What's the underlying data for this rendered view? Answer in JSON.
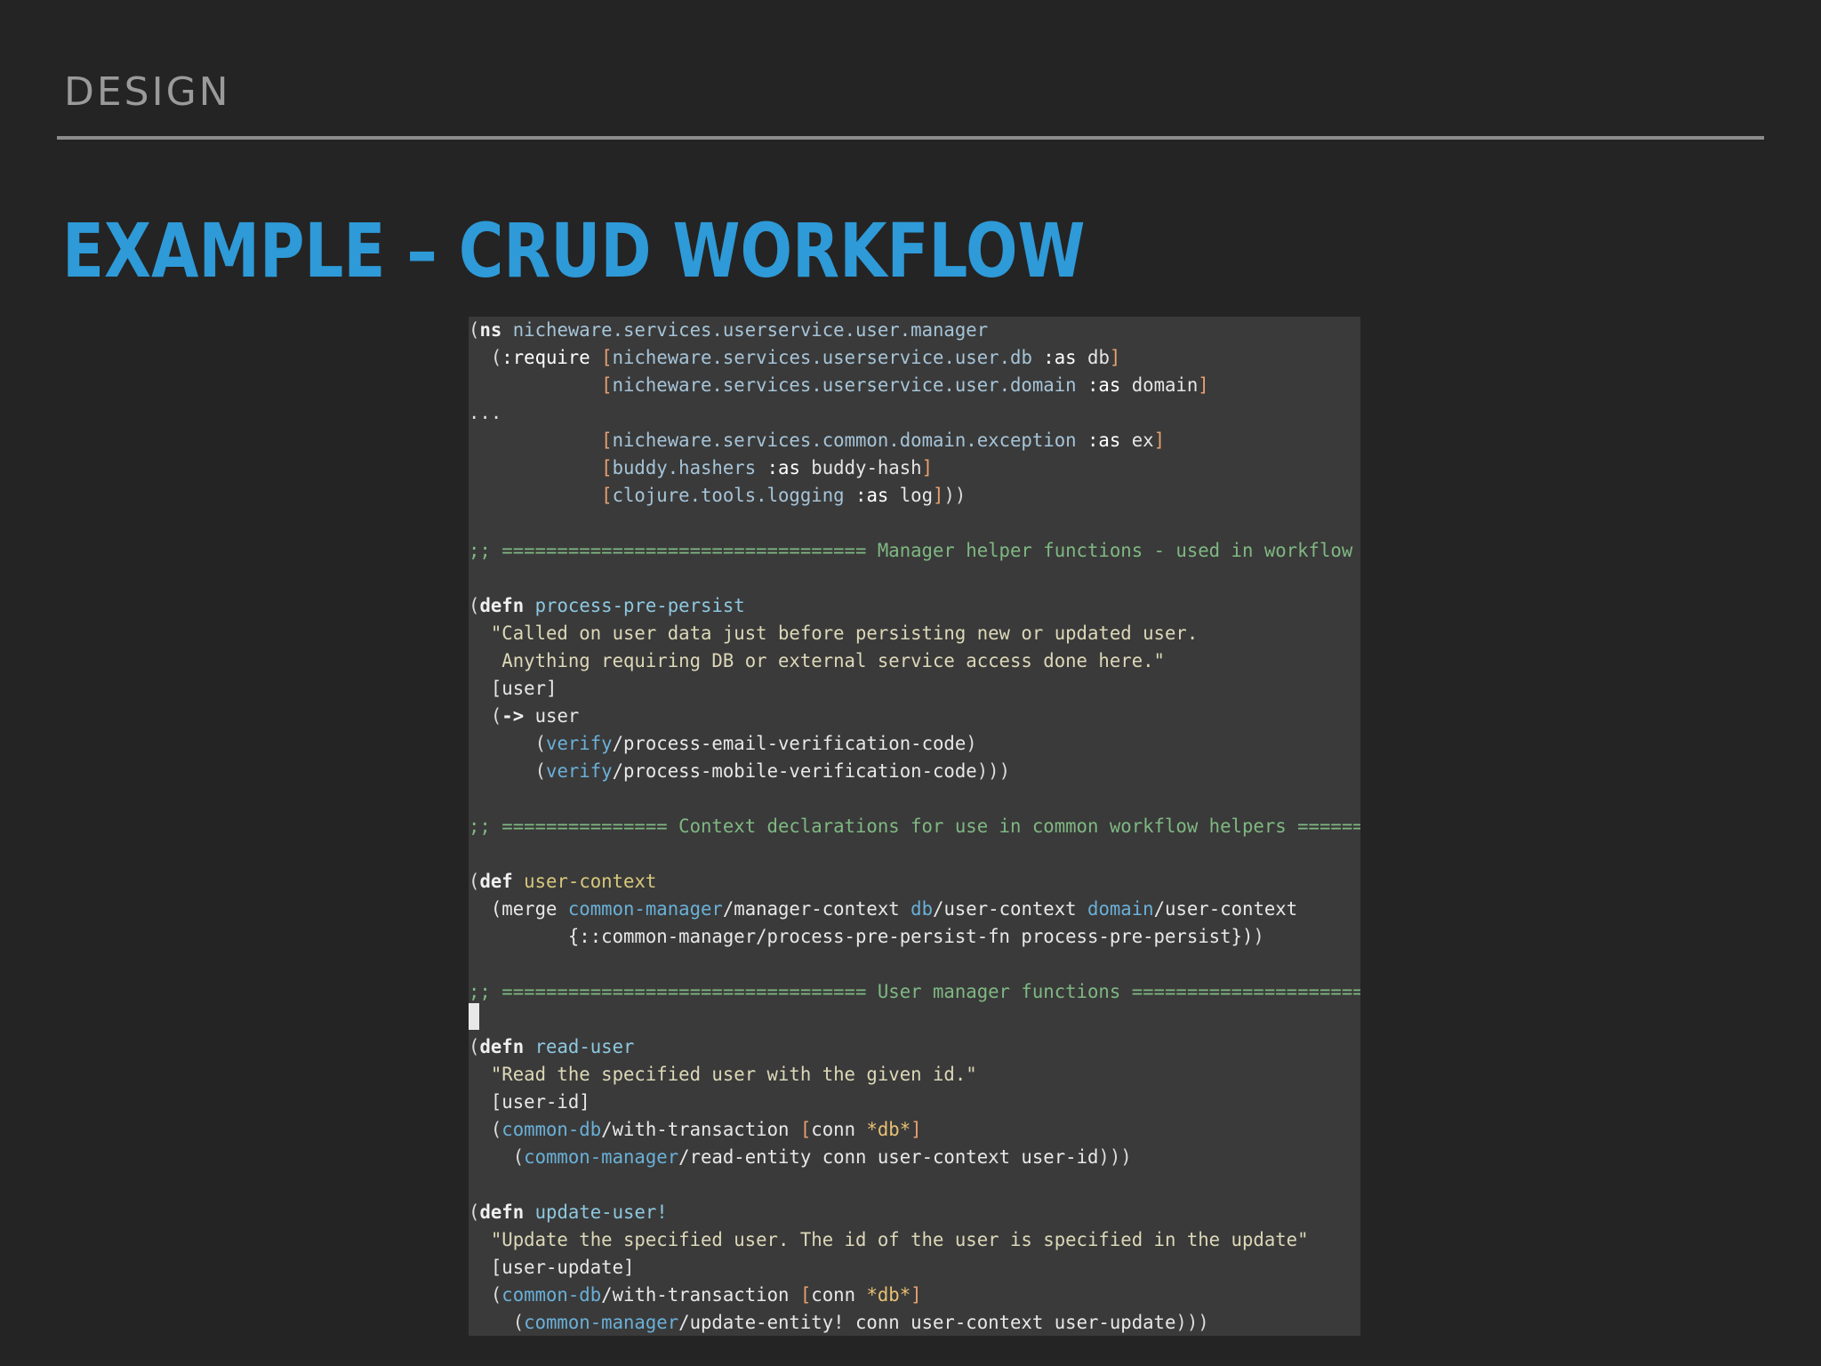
{
  "slide": {
    "section_label": "DESIGN",
    "title": "EXAMPLE – CRUD WORKFLOW"
  },
  "code": {
    "language": "clojure",
    "lines": [
      [
        [
          "(",
          "p"
        ],
        [
          "ns",
          "kw"
        ],
        [
          " nicheware.services.userservice.user.manager",
          "ns"
        ]
      ],
      [
        [
          "  (",
          "p"
        ],
        [
          ":require",
          "kwd"
        ],
        [
          " ",
          "p"
        ],
        [
          "[",
          "br"
        ],
        [
          "nicheware.services.userservice.user.db",
          "ns"
        ],
        [
          " :as ",
          "kwd"
        ],
        [
          "db",
          "nm"
        ],
        [
          "]",
          "br"
        ]
      ],
      [
        [
          "            ",
          "p"
        ],
        [
          "[",
          "br"
        ],
        [
          "nicheware.services.userservice.user.domain",
          "ns"
        ],
        [
          " :as ",
          "kwd"
        ],
        [
          "domain",
          "nm"
        ],
        [
          "]",
          "br"
        ]
      ],
      [
        [
          "...",
          "p"
        ]
      ],
      [
        [
          "            ",
          "p"
        ],
        [
          "[",
          "br"
        ],
        [
          "nicheware.services.common.domain.exception",
          "ns"
        ],
        [
          " :as ",
          "kwd"
        ],
        [
          "ex",
          "nm"
        ],
        [
          "]",
          "br"
        ]
      ],
      [
        [
          "            ",
          "p"
        ],
        [
          "[",
          "br"
        ],
        [
          "buddy.hashers",
          "ns"
        ],
        [
          " :as ",
          "kwd"
        ],
        [
          "buddy-hash",
          "nm"
        ],
        [
          "]",
          "br"
        ]
      ],
      [
        [
          "            ",
          "p"
        ],
        [
          "[",
          "br"
        ],
        [
          "clojure.tools.logging",
          "ns"
        ],
        [
          " :as ",
          "kwd"
        ],
        [
          "log",
          "nm"
        ],
        [
          "]",
          "br"
        ],
        [
          "))",
          "p"
        ]
      ],
      [
        [
          "",
          "p"
        ]
      ],
      [
        [
          ";; ================================= Manager helper functions - used in workflow =====",
          "cm"
        ]
      ],
      [
        [
          "",
          "p"
        ]
      ],
      [
        [
          "(",
          "p"
        ],
        [
          "defn",
          "kw"
        ],
        [
          " ",
          "p"
        ],
        [
          "process-pre-persist",
          "def"
        ]
      ],
      [
        [
          "  \"Called on user data just before persisting new or updated user.",
          "str"
        ]
      ],
      [
        [
          "   Anything requiring DB or external service access done here.\"",
          "str"
        ]
      ],
      [
        [
          "  [user]",
          "sym"
        ]
      ],
      [
        [
          "  (",
          "p"
        ],
        [
          "->",
          "kw"
        ],
        [
          " user",
          "sym"
        ]
      ],
      [
        [
          "      (",
          "p"
        ],
        [
          "verify",
          "qual"
        ],
        [
          "/process-email-verification-code",
          "sym"
        ],
        [
          ")",
          "p"
        ]
      ],
      [
        [
          "      (",
          "p"
        ],
        [
          "verify",
          "qual"
        ],
        [
          "/process-mobile-verification-code",
          "sym"
        ],
        [
          ")))",
          "p"
        ]
      ],
      [
        [
          "",
          "p"
        ]
      ],
      [
        [
          ";; =============== Context declarations for use in common workflow helpers =======",
          "cm"
        ]
      ],
      [
        [
          "",
          "p"
        ]
      ],
      [
        [
          "(",
          "p"
        ],
        [
          "def",
          "kw"
        ],
        [
          " ",
          "p"
        ],
        [
          "user-context",
          "def2"
        ]
      ],
      [
        [
          "  (merge ",
          "sym"
        ],
        [
          "common-manager",
          "qual"
        ],
        [
          "/manager-context ",
          "sym"
        ],
        [
          "db",
          "qual"
        ],
        [
          "/user-context ",
          "sym"
        ],
        [
          "domain",
          "qual"
        ],
        [
          "/user-context",
          "sym"
        ]
      ],
      [
        [
          "         {::common-manager/process-pre-persist-fn process-pre-persist})",
          "sym"
        ],
        [
          ")",
          "p"
        ]
      ],
      [
        [
          "",
          "p"
        ]
      ],
      [
        [
          ";; ================================= User manager functions ================================",
          "cm"
        ]
      ],
      [
        [
          "",
          "p"
        ]
      ],
      [
        [
          "(",
          "p"
        ],
        [
          "defn",
          "kw"
        ],
        [
          " ",
          "p"
        ],
        [
          "read-user",
          "def"
        ]
      ],
      [
        [
          "  \"Read the specified user with the given id.\"",
          "str"
        ]
      ],
      [
        [
          "  [user-id]",
          "sym"
        ]
      ],
      [
        [
          "  (",
          "p"
        ],
        [
          "common-db",
          "qual"
        ],
        [
          "/with-transaction ",
          "sym"
        ],
        [
          "[",
          "br"
        ],
        [
          "conn ",
          "sym"
        ],
        [
          "*db*",
          "dyn"
        ],
        [
          "]",
          "br"
        ]
      ],
      [
        [
          "    (",
          "p"
        ],
        [
          "common-manager",
          "qual"
        ],
        [
          "/read-entity conn user-context user-id",
          "sym"
        ],
        [
          ")))",
          "p"
        ]
      ],
      [
        [
          "",
          "p"
        ]
      ],
      [
        [
          "(",
          "p"
        ],
        [
          "defn",
          "kw"
        ],
        [
          " ",
          "p"
        ],
        [
          "update-user!",
          "def"
        ]
      ],
      [
        [
          "  \"Update the specified user. The id of the user is specified in the update\"",
          "str"
        ]
      ],
      [
        [
          "  [user-update]",
          "sym"
        ]
      ],
      [
        [
          "  (",
          "p"
        ],
        [
          "common-db",
          "qual"
        ],
        [
          "/with-transaction ",
          "sym"
        ],
        [
          "[",
          "br"
        ],
        [
          "conn ",
          "sym"
        ],
        [
          "*db*",
          "dyn"
        ],
        [
          "]",
          "br"
        ]
      ],
      [
        [
          "    (",
          "p"
        ],
        [
          "common-manager",
          "qual"
        ],
        [
          "/update-entity! conn user-context user-update",
          "sym"
        ],
        [
          ")))",
          "p"
        ]
      ]
    ]
  }
}
